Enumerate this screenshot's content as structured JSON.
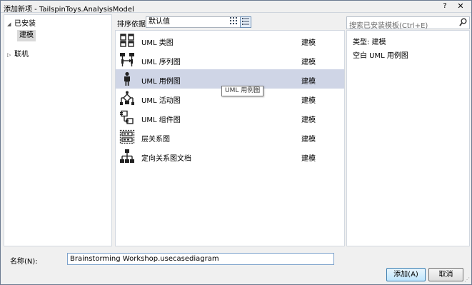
{
  "window": {
    "title": "添加新项 - TailspinToys.AnalysisModel",
    "help": "?",
    "close": "✕"
  },
  "tree": {
    "installed": "已安装",
    "modeling": "建模",
    "online": "联机"
  },
  "toolbar": {
    "sort_label": "排序依据:",
    "sort_value": "默认值",
    "grid_view_icon": "grid-view-icon",
    "list_view_icon": "list-view-icon"
  },
  "templates": [
    {
      "name": "UML 类图",
      "category": "建模",
      "icon": "uml-class-diagram-icon"
    },
    {
      "name": "UML 序列图",
      "category": "建模",
      "icon": "uml-sequence-diagram-icon"
    },
    {
      "name": "UML 用例图",
      "category": "建模",
      "icon": "uml-usecase-diagram-icon"
    },
    {
      "name": "UML 活动图",
      "category": "建模",
      "icon": "uml-activity-diagram-icon"
    },
    {
      "name": "UML 组件图",
      "category": "建模",
      "icon": "uml-component-diagram-icon"
    },
    {
      "name": "层关系图",
      "category": "建模",
      "icon": "layer-diagram-icon"
    },
    {
      "name": "定向关系图文档",
      "category": "建模",
      "icon": "directed-graph-icon"
    }
  ],
  "tooltip": "UML 用例图",
  "search": {
    "placeholder": "搜索已安装模板(Ctrl+E)"
  },
  "detail": {
    "type": "类型:  建模",
    "description": "空白 UML 用例图"
  },
  "bottom": {
    "name_label": "名称(N):",
    "name_value": "Brainstorming Workshop.usecasediagram",
    "add_button": "添加(A)",
    "cancel_button": "取消"
  }
}
